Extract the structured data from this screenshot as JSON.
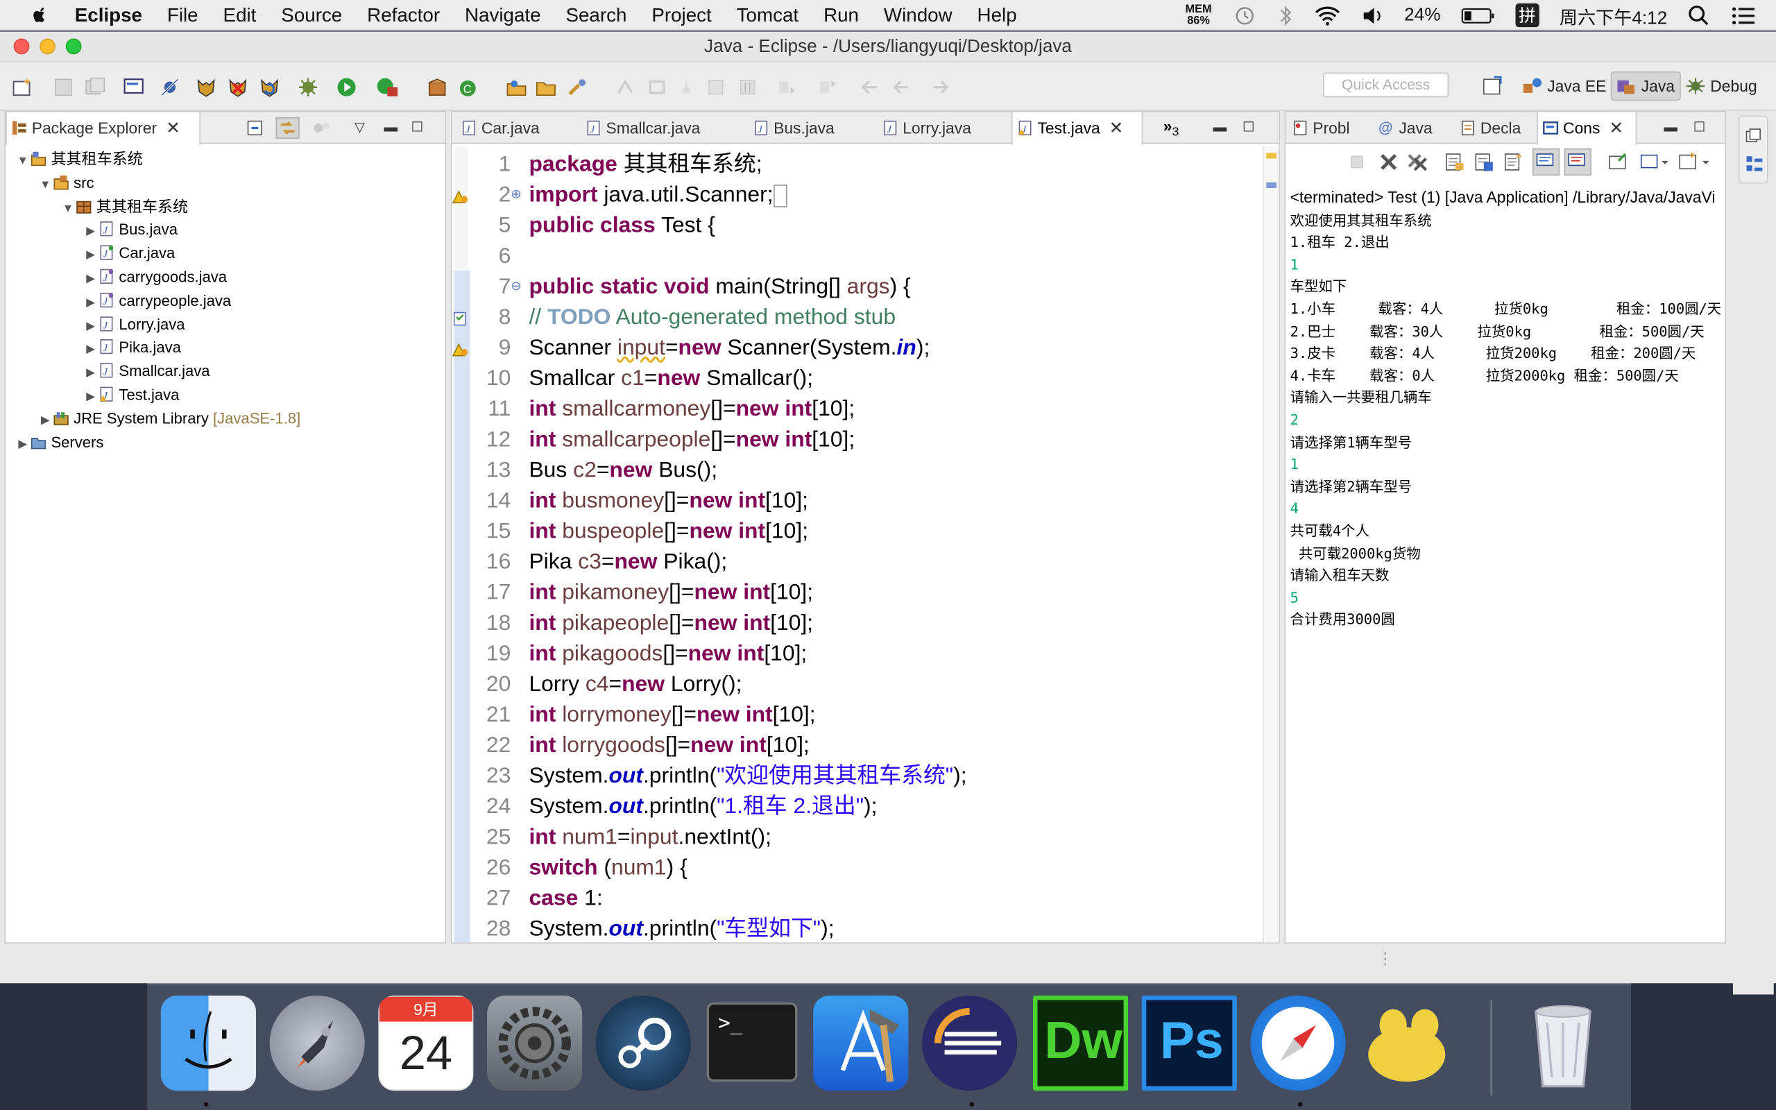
{
  "menubar": {
    "app": "Eclipse",
    "items": [
      "File",
      "Edit",
      "Source",
      "Refactor",
      "Navigate",
      "Search",
      "Project",
      "Tomcat",
      "Run",
      "Window",
      "Help"
    ],
    "mem_label": "MEM",
    "mem_value": "86%",
    "battery": "24%",
    "input_method": "拼",
    "clock": "周六下午4:12"
  },
  "window": {
    "title": "Java - Eclipse - /Users/liangyuqi/Desktop/java"
  },
  "toolbar": {
    "quick_access_placeholder": "Quick Access",
    "perspectives": [
      "Java EE",
      "Java",
      "Debug"
    ]
  },
  "package_explorer": {
    "tab": "Package Explorer",
    "tree": [
      {
        "label": "其其租车系统",
        "type": "project"
      },
      {
        "label": "src",
        "type": "folder"
      },
      {
        "label": "其其租车系统",
        "type": "package"
      },
      {
        "label": "Bus.java",
        "type": "file"
      },
      {
        "label": "Car.java",
        "type": "file"
      },
      {
        "label": "carrygoods.java",
        "type": "file"
      },
      {
        "label": "carrypeople.java",
        "type": "file"
      },
      {
        "label": "Lorry.java",
        "type": "file"
      },
      {
        "label": "Pika.java",
        "type": "file"
      },
      {
        "label": "Smallcar.java",
        "type": "file"
      },
      {
        "label": "Test.java",
        "type": "file"
      },
      {
        "label": "JRE System Library",
        "suffix": "[JavaSE-1.8]",
        "type": "library"
      },
      {
        "label": "Servers",
        "type": "folder"
      }
    ]
  },
  "editor": {
    "tabs": [
      "Car.java",
      "Smallcar.java",
      "Bus.java",
      "Lorry.java",
      "Test.java"
    ],
    "active_tab": "Test.java",
    "overflow": "3",
    "lines": [
      {
        "n": "1",
        "t": "package 其其租车系统;"
      },
      {
        "n": "2",
        "t": "import java.util.Scanner;"
      },
      {
        "n": "5",
        "t": "public class Test {"
      },
      {
        "n": "6",
        "t": ""
      },
      {
        "n": "7",
        "t": "    public static void main(String[] args) {"
      },
      {
        "n": "8",
        "t": "        // TODO Auto-generated method stub"
      },
      {
        "n": "9",
        "t": "Scanner input=new Scanner(System.in);"
      },
      {
        "n": "10",
        "t": "Smallcar c1=new Smallcar();"
      },
      {
        "n": "11",
        "t": "int smallcarmoney[]=new int[10];"
      },
      {
        "n": "12",
        "t": "int smallcarpeople[]=new int[10];"
      },
      {
        "n": "13",
        "t": "Bus c2=new Bus();"
      },
      {
        "n": "14",
        "t": "int busmoney[]=new int[10];"
      },
      {
        "n": "15",
        "t": "int buspeople[]=new int[10];"
      },
      {
        "n": "16",
        "t": "Pika c3=new Pika();"
      },
      {
        "n": "17",
        "t": "int pikamoney[]=new int[10];"
      },
      {
        "n": "18",
        "t": "int pikapeople[]=new int[10];"
      },
      {
        "n": "19",
        "t": "int pikagoods[]=new int[10];"
      },
      {
        "n": "20",
        "t": "Lorry c4=new Lorry();"
      },
      {
        "n": "21",
        "t": "int lorrymoney[]=new int[10];"
      },
      {
        "n": "22",
        "t": "int lorrygoods[]=new int[10];"
      },
      {
        "n": "23",
        "t": "System.out.println(\"欢迎使用其其租车系统\");"
      },
      {
        "n": "24",
        "t": "System.out.println(\"1.租车 2.退出\");"
      },
      {
        "n": "25",
        "t": "int num1=input.nextInt();"
      },
      {
        "n": "26",
        "t": "switch (num1) {"
      },
      {
        "n": "27",
        "t": "case 1:"
      },
      {
        "n": "28",
        "t": "    System.out.println(\"车型如下\");"
      }
    ]
  },
  "console": {
    "tabs": [
      "Probl",
      "Java",
      "Decla",
      "Cons"
    ],
    "header": "<terminated> Test (1) [Java Application] /Library/Java/JavaVi",
    "lines": [
      {
        "t": "欢迎使用其其租车系统",
        "in": false
      },
      {
        "t": "1.租车 2.退出",
        "in": false
      },
      {
        "t": "1",
        "in": true
      },
      {
        "t": "车型如下",
        "in": false
      },
      {
        "t": "1.小车     载客：4人      拉货0kg        租金：100圆/天",
        "in": false
      },
      {
        "t": "2.巴士    载客：30人    拉货0kg        租金：500圆/天",
        "in": false
      },
      {
        "t": "3.皮卡    载客：4人      拉货200kg    租金：200圆/天",
        "in": false
      },
      {
        "t": "4.卡车    载客：0人      拉货2000kg 租金：500圆/天",
        "in": false
      },
      {
        "t": "请输入一共要租几辆车",
        "in": false
      },
      {
        "t": "2",
        "in": true
      },
      {
        "t": "请选择第1辆车型号",
        "in": false
      },
      {
        "t": "1",
        "in": true
      },
      {
        "t": "请选择第2辆车型号",
        "in": false
      },
      {
        "t": "4",
        "in": true
      },
      {
        "t": "共可载4个人",
        "in": false
      },
      {
        "t": " 共可载2000kg货物",
        "in": false
      },
      {
        "t": "请输入租车天数",
        "in": false
      },
      {
        "t": "5",
        "in": true
      },
      {
        "t": "合计费用3000圆",
        "in": false
      }
    ]
  },
  "dock": {
    "apps": [
      "finder-icon",
      "launchpad-icon",
      "calendar-icon",
      "system-preferences-icon",
      "steam-icon",
      "terminal-icon",
      "xcode-icon",
      "eclipse-icon",
      "dreamweaver-icon",
      "photoshop-icon",
      "safari-icon",
      "yoink-icon",
      "trash-icon"
    ],
    "calendar_month": "9月",
    "calendar_day": "24",
    "dw_label": "Dw",
    "ps_label": "Ps",
    "terminal_prompt": ">_"
  }
}
